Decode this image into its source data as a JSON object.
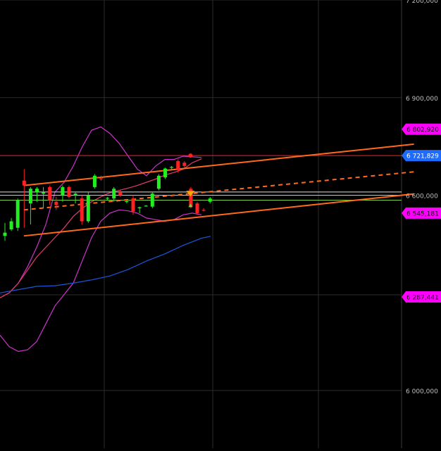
{
  "chart_data": {
    "type": "candlestick",
    "ylim": [
      6000000,
      7200000
    ],
    "y_ticks": [
      {
        "value": 7200000,
        "label": "7 200,000"
      },
      {
        "value": 6900000,
        "label": "6 900,000"
      },
      {
        "value": 6600000,
        "label": "6 600,000"
      },
      {
        "value": 6000000,
        "label": "6 000,000"
      }
    ],
    "price_tags": [
      {
        "value": 6802920,
        "label": "6 802,920",
        "color": "#ff00ff"
      },
      {
        "value": 6721829,
        "label": "6 721,829",
        "color": "#1e6bff"
      },
      {
        "value": 6545181,
        "label": "6 545,181",
        "color": "#ff00ff"
      },
      {
        "value": 6287441,
        "label": "6 287,441",
        "color": "#ff00ff"
      }
    ],
    "horizontal_lines": [
      {
        "value": 6721829,
        "color": "#ff2020"
      },
      {
        "value": 6610000,
        "color": "#e0e0e0"
      },
      {
        "value": 6600000,
        "color": "#ffd200"
      },
      {
        "value": 6585000,
        "color": "#7ccd4a"
      }
    ],
    "candles": [
      {
        "o": 6475000,
        "h": 6515000,
        "l": 6460000,
        "c": 6485000
      },
      {
        "o": 6495000,
        "h": 6530000,
        "l": 6490000,
        "c": 6520000
      },
      {
        "o": 6500000,
        "h": 6590000,
        "l": 6490000,
        "c": 6585000
      },
      {
        "o": 6645000,
        "h": 6680000,
        "l": 6500000,
        "c": 6630000
      },
      {
        "o": 6575000,
        "h": 6625000,
        "l": 6510000,
        "c": 6620000
      },
      {
        "o": 6610000,
        "h": 6625000,
        "l": 6580000,
        "c": 6620000
      },
      {
        "o": 6605000,
        "h": 6625000,
        "l": 6560000,
        "c": 6610000
      },
      {
        "o": 6625000,
        "h": 6630000,
        "l": 6570000,
        "c": 6585000
      },
      {
        "o": 6580000,
        "h": 6595000,
        "l": 6555000,
        "c": 6570000
      },
      {
        "o": 6600000,
        "h": 6630000,
        "l": 6580000,
        "c": 6625000
      },
      {
        "o": 6625000,
        "h": 6630000,
        "l": 6590000,
        "c": 6595000
      },
      {
        "o": 6600000,
        "h": 6610000,
        "l": 6575000,
        "c": 6605000
      },
      {
        "o": 6590000,
        "h": 6600000,
        "l": 6510000,
        "c": 6520000
      },
      {
        "o": 6520000,
        "h": 6610000,
        "l": 6515000,
        "c": 6600000
      },
      {
        "o": 6625000,
        "h": 6665000,
        "l": 6620000,
        "c": 6660000
      },
      {
        "o": 6652000,
        "h": 6660000,
        "l": 6645000,
        "c": 6650000
      },
      {
        "o": 6590000,
        "h": 6595000,
        "l": 6585000,
        "c": 6592000
      },
      {
        "o": 6590000,
        "h": 6625000,
        "l": 6580000,
        "c": 6620000
      },
      {
        "o": 6608000,
        "h": 6615000,
        "l": 6595000,
        "c": 6600000
      },
      {
        "o": 6580000,
        "h": 6585000,
        "l": 6575000,
        "c": 6582000
      },
      {
        "o": 6590000,
        "h": 6600000,
        "l": 6540000,
        "c": 6550000
      },
      {
        "o": 6560000,
        "h": 6565000,
        "l": 6545000,
        "c": 6563000
      },
      {
        "o": 6568000,
        "h": 6570000,
        "l": 6565000,
        "c": 6568000
      },
      {
        "o": 6565000,
        "h": 6610000,
        "l": 6560000,
        "c": 6605000
      },
      {
        "o": 6620000,
        "h": 6665000,
        "l": 6615000,
        "c": 6660000
      },
      {
        "o": 6655000,
        "h": 6685000,
        "l": 6650000,
        "c": 6682000
      },
      {
        "o": 6685000,
        "h": 6690000,
        "l": 6680000,
        "c": 6687000
      },
      {
        "o": 6705000,
        "h": 6710000,
        "l": 6670000,
        "c": 6677000
      },
      {
        "o": 6700000,
        "h": 6705000,
        "l": 6685000,
        "c": 6690000
      },
      {
        "o": 6620000,
        "h": 6625000,
        "l": 6560000,
        "c": 6565000
      },
      {
        "o": 6575000,
        "h": 6580000,
        "l": 6540000,
        "c": 6545000
      },
      {
        "o": 6555000,
        "h": 6560000,
        "l": 6550000,
        "c": 6553000
      },
      {
        "o": 6580000,
        "h": 6595000,
        "l": 6575000,
        "c": 6590000
      }
    ],
    "bollinger_upper": [
      [
        0,
        6285000
      ],
      [
        5,
        6300000
      ],
      [
        10,
        6330000
      ],
      [
        15,
        6380000
      ],
      [
        20,
        6440000
      ],
      [
        25,
        6510000
      ],
      [
        30,
        6610000
      ],
      [
        35,
        6640000
      ],
      [
        40,
        6690000
      ],
      [
        45,
        6750000
      ],
      [
        50,
        6800000
      ],
      [
        55,
        6810000
      ],
      [
        60,
        6790000
      ],
      [
        65,
        6760000
      ],
      [
        70,
        6720000
      ],
      [
        75,
        6680000
      ],
      [
        80,
        6660000
      ],
      [
        85,
        6690000
      ],
      [
        90,
        6710000
      ],
      [
        95,
        6710000
      ],
      [
        100,
        6720000
      ],
      [
        105,
        6718000
      ],
      [
        110,
        6716000
      ]
    ],
    "bollinger_mid": [
      [
        0,
        6285000
      ],
      [
        5,
        6300000
      ],
      [
        10,
        6330000
      ],
      [
        15,
        6370000
      ],
      [
        20,
        6410000
      ],
      [
        25,
        6440000
      ],
      [
        30,
        6470000
      ],
      [
        35,
        6500000
      ],
      [
        40,
        6535000
      ],
      [
        45,
        6560000
      ],
      [
        50,
        6580000
      ],
      [
        55,
        6595000
      ],
      [
        60,
        6608000
      ],
      [
        65,
        6615000
      ],
      [
        70,
        6622000
      ],
      [
        75,
        6630000
      ],
      [
        80,
        6640000
      ],
      [
        85,
        6650000
      ],
      [
        90,
        6662000
      ],
      [
        95,
        6670000
      ],
      [
        100,
        6680000
      ],
      [
        105,
        6700000
      ],
      [
        110,
        6712000
      ]
    ],
    "bollinger_lower": [
      [
        0,
        6170000
      ],
      [
        5,
        6135000
      ],
      [
        10,
        6120000
      ],
      [
        15,
        6125000
      ],
      [
        20,
        6150000
      ],
      [
        25,
        6205000
      ],
      [
        30,
        6260000
      ],
      [
        35,
        6295000
      ],
      [
        40,
        6330000
      ],
      [
        45,
        6400000
      ],
      [
        50,
        6470000
      ],
      [
        55,
        6520000
      ],
      [
        60,
        6545000
      ],
      [
        65,
        6555000
      ],
      [
        70,
        6552000
      ],
      [
        75,
        6545000
      ],
      [
        80,
        6530000
      ],
      [
        85,
        6525000
      ],
      [
        90,
        6520000
      ],
      [
        95,
        6525000
      ],
      [
        100,
        6540000
      ],
      [
        105,
        6545000
      ],
      [
        110,
        6540000
      ]
    ],
    "moving_average": [
      [
        0,
        6300000
      ],
      [
        10,
        6310000
      ],
      [
        20,
        6320000
      ],
      [
        30,
        6322000
      ],
      [
        40,
        6330000
      ],
      [
        50,
        6340000
      ],
      [
        60,
        6352000
      ],
      [
        70,
        6372000
      ],
      [
        80,
        6398000
      ],
      [
        90,
        6420000
      ],
      [
        100,
        6446000
      ],
      [
        110,
        6468000
      ],
      [
        115,
        6474000
      ]
    ],
    "channel": {
      "upper": {
        "from": [
          13,
          6630000
        ],
        "to": [
          226,
          6757000
        ]
      },
      "middle": {
        "from": [
          13,
          6555000
        ],
        "to": [
          226,
          6672000
        ]
      },
      "lower": {
        "from": [
          13,
          6475000
        ],
        "to": [
          226,
          6604000
        ]
      },
      "middle_solid_until": 103
    },
    "markers": [
      {
        "type": "dot",
        "x": 104,
        "value": 6722000,
        "color": "#ff2020"
      },
      {
        "type": "triangle-down",
        "x": 104,
        "value": 6605000,
        "color": "#ffa500"
      },
      {
        "type": "arrow-up",
        "x": 104,
        "value": 6570000,
        "color": "#7ccd4a"
      }
    ]
  },
  "colors": {
    "up": "#22ee22",
    "down": "#ff2222",
    "grid": "#2b2b2b",
    "axis_text": "#bdbdbd",
    "bollinger": "#cc33cc",
    "bollinger_mid": "#e23a6e",
    "moving_average": "#1d57d8",
    "channel": "#ff6a1a"
  }
}
